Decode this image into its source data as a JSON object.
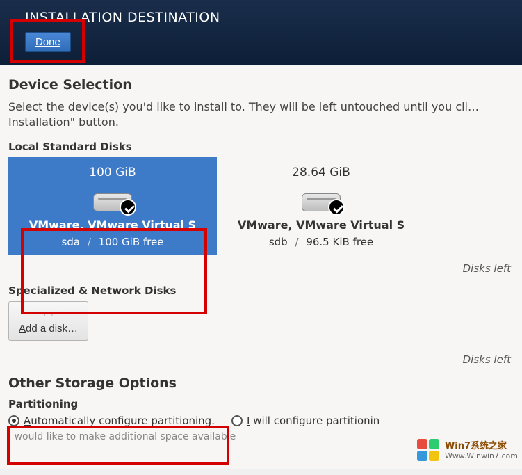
{
  "header": {
    "title": "INSTALLATION DESTINATION",
    "done_label": "Done"
  },
  "device_selection": {
    "heading": "Device Selection",
    "instruction": "Select the device(s) you'd like to install to.  They will be left untouched until you cli… Installation\" button.",
    "local_disks_label": "Local Standard Disks",
    "disks": [
      {
        "size": "100 GiB",
        "name": "VMware, VMware Virtual S",
        "id": "sda",
        "free": "100 GiB free",
        "selected": true
      },
      {
        "size": "28.64 GiB",
        "name": "VMware, VMware Virtual S",
        "id": "sdb",
        "free": "96.5 KiB free",
        "selected": false
      }
    ],
    "disks_left_note": "Disks left",
    "specialized_label": "Specialized & Network Disks",
    "add_disk_label": "Add a disk…",
    "disks_left_note2": "Disks left"
  },
  "other_storage": {
    "heading": "Other Storage Options",
    "partitioning_label": "Partitioning",
    "auto_label": "Automatically configure partitioning.",
    "auto_selected": true,
    "manual_label": "I will configure partitionin",
    "cutoff_line": "I would like to make additional space available"
  },
  "watermark": {
    "line1": "Win7系统之家",
    "line2": "Www.Winwin7.com"
  }
}
